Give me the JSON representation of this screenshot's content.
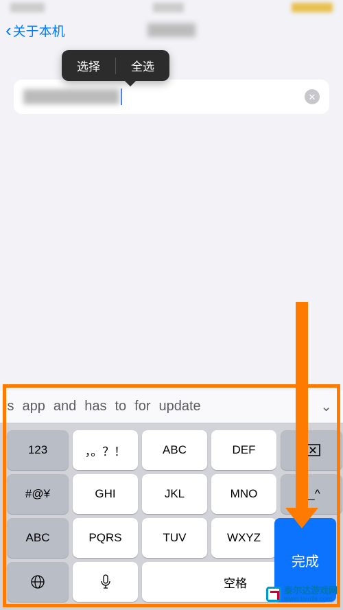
{
  "nav": {
    "back_title": "关于本机"
  },
  "popup": {
    "select": "选择",
    "select_all": "全选"
  },
  "suggestions": [
    "is",
    "app",
    "and",
    "has",
    "to",
    "for",
    "update"
  ],
  "keys": {
    "r1c1": "123",
    "r1c2": "，。？！",
    "r1c3": "ABC",
    "r1c4": "DEF",
    "r2c1": "#@¥",
    "r2c2": "GHI",
    "r2c3": "JKL",
    "r2c4": "MNO",
    "r2c5": "^_^",
    "r3c1": "ABC",
    "r3c2": "PQRS",
    "r3c3": "TUV",
    "r3c4": "WXYZ",
    "done": "完成",
    "space": "空格"
  },
  "watermark": {
    "name": "泰尔达游戏网",
    "url": "www.tairda.com"
  }
}
